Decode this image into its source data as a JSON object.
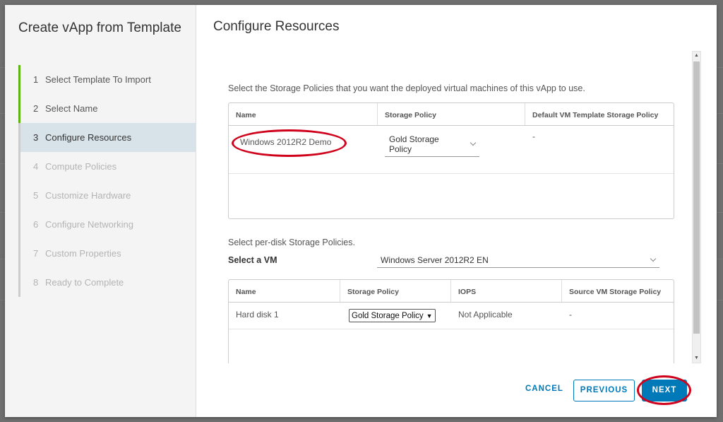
{
  "wizard": {
    "title": "Create vApp from Template",
    "steps": [
      {
        "num": "1",
        "label": "Select Template To Import",
        "state": "done"
      },
      {
        "num": "2",
        "label": "Select Name",
        "state": "done"
      },
      {
        "num": "3",
        "label": "Configure Resources",
        "state": "current"
      },
      {
        "num": "4",
        "label": "Compute Policies",
        "state": "future"
      },
      {
        "num": "5",
        "label": "Customize Hardware",
        "state": "future"
      },
      {
        "num": "6",
        "label": "Configure Networking",
        "state": "future"
      },
      {
        "num": "7",
        "label": "Custom Properties",
        "state": "future"
      },
      {
        "num": "8",
        "label": "Ready to Complete",
        "state": "future"
      }
    ]
  },
  "page": {
    "title": "Configure Resources",
    "vm_policies_desc": "Select the Storage Policies that you want the deployed virtual machines of this vApp to use.",
    "vm_grid": {
      "headers": [
        "Name",
        "Storage Policy",
        "Default VM Template Storage Policy"
      ],
      "rows": [
        {
          "name": "Windows 2012R2 Demo",
          "policy": "Gold Storage Policy",
          "default_policy": "-"
        }
      ]
    },
    "disk_policies_desc": "Select per-disk Storage Policies.",
    "select_vm_label": "Select a VM",
    "select_vm_value": "Windows Server 2012R2 EN",
    "disk_grid": {
      "headers": [
        "Name",
        "Storage Policy",
        "IOPS",
        "Source VM Storage Policy"
      ],
      "rows": [
        {
          "name": "Hard disk 1",
          "policy": "Gold Storage Policy",
          "iops": "Not Applicable",
          "source_policy": "-"
        }
      ]
    }
  },
  "footer": {
    "cancel": "CANCEL",
    "previous": "PREVIOUS",
    "next": "NEXT"
  },
  "colors": {
    "accent": "#0079b8",
    "done_step": "#60b515",
    "annotation": "#d0021b"
  }
}
